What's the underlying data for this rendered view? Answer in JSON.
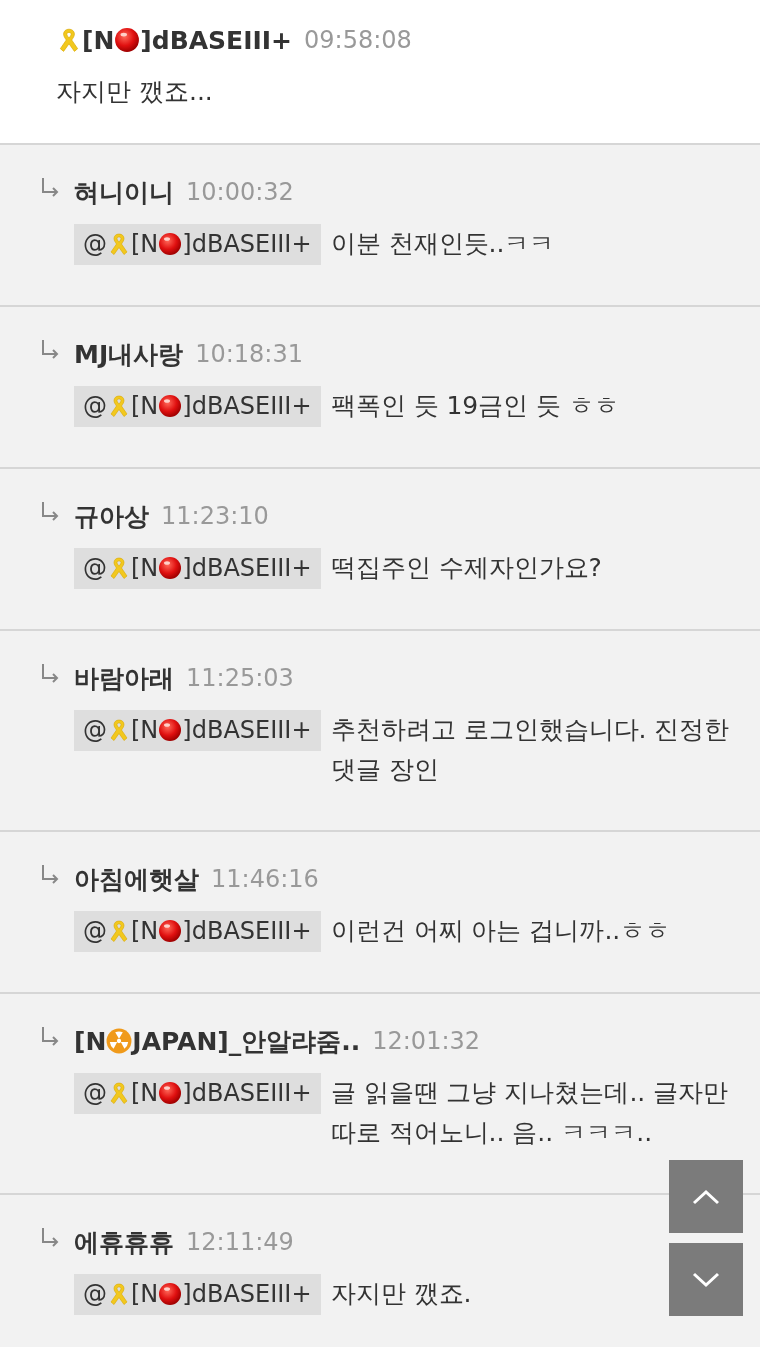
{
  "post": {
    "author": [
      {
        "kind": "ribbon"
      },
      {
        "kind": "text",
        "text": "[N"
      },
      {
        "kind": "ball"
      },
      {
        "kind": "text",
        "text": "]dBASEIII+"
      }
    ],
    "time": "09:58:08",
    "text": "자지만 깼죠..."
  },
  "replies": [
    {
      "author": [
        {
          "kind": "text",
          "text": "혀니이니"
        }
      ],
      "time": "10:00:32",
      "mention": [
        {
          "kind": "text",
          "text": "@"
        },
        {
          "kind": "ribbon"
        },
        {
          "kind": "text",
          "text": "[N"
        },
        {
          "kind": "ball"
        },
        {
          "kind": "text",
          "text": "]dBASEIII+"
        }
      ],
      "text": "이분 천재인듯..ㅋㅋ"
    },
    {
      "author": [
        {
          "kind": "text",
          "text": "MJ내사랑"
        }
      ],
      "time": "10:18:31",
      "mention": [
        {
          "kind": "text",
          "text": "@"
        },
        {
          "kind": "ribbon"
        },
        {
          "kind": "text",
          "text": "[N"
        },
        {
          "kind": "ball"
        },
        {
          "kind": "text",
          "text": "]dBASEIII+"
        }
      ],
      "text": "팩폭인 듯 19금인 듯 ㅎㅎ"
    },
    {
      "author": [
        {
          "kind": "text",
          "text": "규아상"
        }
      ],
      "time": "11:23:10",
      "mention": [
        {
          "kind": "text",
          "text": "@"
        },
        {
          "kind": "ribbon"
        },
        {
          "kind": "text",
          "text": "[N"
        },
        {
          "kind": "ball"
        },
        {
          "kind": "text",
          "text": "]dBASEIII+"
        }
      ],
      "text": "떡집주인 수제자인가요?"
    },
    {
      "author": [
        {
          "kind": "text",
          "text": "바람아래"
        }
      ],
      "time": "11:25:03",
      "mention": [
        {
          "kind": "text",
          "text": "@"
        },
        {
          "kind": "ribbon"
        },
        {
          "kind": "text",
          "text": "[N"
        },
        {
          "kind": "ball"
        },
        {
          "kind": "text",
          "text": "]dBASEIII+"
        }
      ],
      "text": "추천하려고 로그인했습니다. 진정한 댓글 장인"
    },
    {
      "author": [
        {
          "kind": "text",
          "text": "아침에햇살"
        }
      ],
      "time": "11:46:16",
      "mention": [
        {
          "kind": "text",
          "text": "@"
        },
        {
          "kind": "ribbon"
        },
        {
          "kind": "text",
          "text": "[N"
        },
        {
          "kind": "ball"
        },
        {
          "kind": "text",
          "text": "]dBASEIII+"
        }
      ],
      "text": "이런건 어찌 아는 겁니까..ㅎㅎ"
    },
    {
      "author": [
        {
          "kind": "text",
          "text": "[N"
        },
        {
          "kind": "radiation"
        },
        {
          "kind": "text",
          "text": "JAPAN]_안알랴줌.."
        }
      ],
      "time": "12:01:32",
      "mention": [
        {
          "kind": "text",
          "text": "@"
        },
        {
          "kind": "ribbon"
        },
        {
          "kind": "text",
          "text": "[N"
        },
        {
          "kind": "ball"
        },
        {
          "kind": "text",
          "text": "]dBASEIII+"
        }
      ],
      "text": "글 읽을땐 그냥 지나쳤는데.. 글자만 따로 적어노니.. 음.. ㅋㅋㅋ.."
    },
    {
      "author": [
        {
          "kind": "text",
          "text": "에휴휴휴"
        }
      ],
      "time": "12:11:49",
      "mention": [
        {
          "kind": "text",
          "text": "@"
        },
        {
          "kind": "ribbon"
        },
        {
          "kind": "text",
          "text": "[N"
        },
        {
          "kind": "ball"
        },
        {
          "kind": "text",
          "text": "]dBASEIII+"
        }
      ],
      "text": "자지만 깼죠."
    }
  ]
}
